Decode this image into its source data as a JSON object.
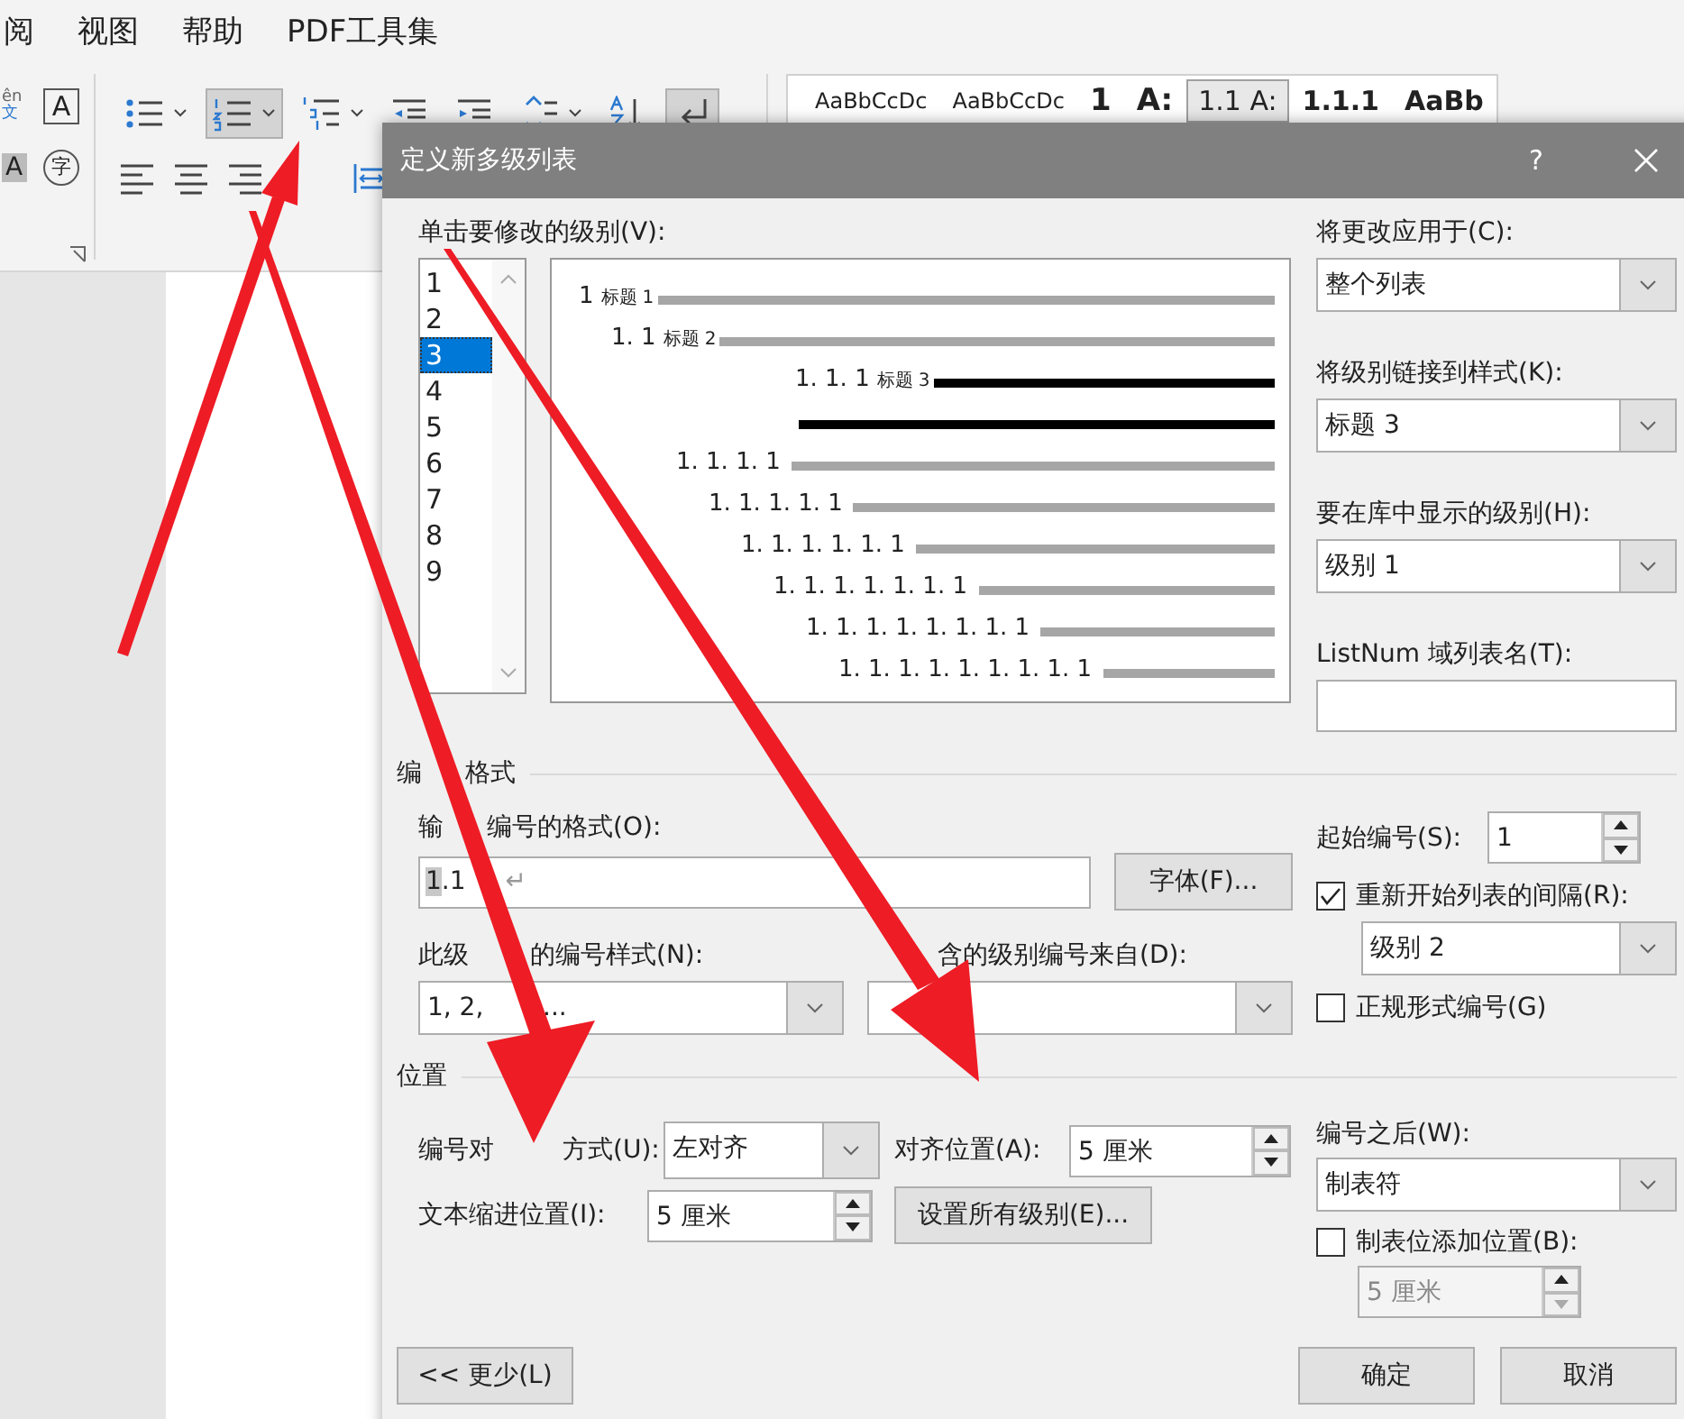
{
  "menu": [
    {
      "label": "阅"
    },
    {
      "label": "视图"
    },
    {
      "label": "帮助"
    },
    {
      "label": "PDF工具集"
    }
  ],
  "ribbon": {
    "phonetic": "ên",
    "phonetic_sub": "文",
    "char_border": "A",
    "char_shading": "A",
    "enclose": "字",
    "row1": [
      {
        "kind": "bullets",
        "selected": false,
        "caret": true
      },
      {
        "kind": "numbering",
        "selected": true,
        "caret": true
      },
      {
        "kind": "multilevel",
        "selected": false,
        "caret": true
      },
      {
        "kind": "outdent",
        "selected": false,
        "caret": false
      },
      {
        "kind": "indent",
        "selected": false,
        "caret": false
      },
      {
        "kind": "spacing",
        "selected": false,
        "caret": true
      },
      {
        "kind": "sort",
        "selected": false,
        "caret": false
      },
      {
        "kind": "marks",
        "selected": true,
        "caret": false
      }
    ],
    "row2": [
      {
        "kind": "left",
        "selected": false
      },
      {
        "kind": "center",
        "selected": false
      },
      {
        "kind": "right",
        "selected": false
      },
      {
        "kind": "distribute",
        "selected": false
      }
    ]
  },
  "styles": [
    {
      "text": "AaBbCcDc",
      "kind": "normal",
      "selected": false
    },
    {
      "text": "AaBbCcDc",
      "kind": "normal",
      "selected": false
    },
    {
      "text": "1",
      "kind": "big",
      "selected": false
    },
    {
      "text": "A:",
      "kind": "big",
      "selected": false
    },
    {
      "text": "1.1  A:",
      "kind": "mid",
      "selected": true
    },
    {
      "text": "1.1.1",
      "kind": "mid",
      "selected": false
    },
    {
      "text": "AaBb",
      "kind": "mid",
      "selected": false
    }
  ],
  "dialog": {
    "title": "定义新多级列表",
    "help": "?",
    "level_label": "单击要修改的级别(V):",
    "levels": [
      {
        "label": "1",
        "selected": false
      },
      {
        "label": "2",
        "selected": false
      },
      {
        "label": "3",
        "selected": true
      },
      {
        "label": "4",
        "selected": false
      },
      {
        "label": "5",
        "selected": false
      },
      {
        "label": "6",
        "selected": false
      },
      {
        "label": "7",
        "selected": false
      },
      {
        "label": "8",
        "selected": false
      },
      {
        "label": "9",
        "selected": false
      }
    ],
    "preview": [
      {
        "number": "1",
        "heading": "标题",
        "heading_level": "1",
        "selected": false
      },
      {
        "number": "1. 1",
        "heading": "标题",
        "heading_level": "2",
        "selected": false
      },
      {
        "number": "1. 1. 1",
        "heading": "标题",
        "heading_level": "3",
        "selected": true
      },
      {
        "number": "1. 1. 1. 1",
        "selected": false
      },
      {
        "number": "1. 1. 1. 1. 1",
        "selected": false
      },
      {
        "number": "1. 1. 1. 1. 1. 1",
        "selected": false
      },
      {
        "number": "1. 1. 1. 1. 1. 1. 1",
        "selected": false
      },
      {
        "number": "1. 1. 1. 1. 1. 1. 1. 1",
        "selected": false
      },
      {
        "number": "1. 1. 1. 1. 1. 1. 1. 1. 1",
        "selected": false
      }
    ],
    "apply_to": {
      "label": "将更改应用于(C):",
      "value": "整个列表"
    },
    "link_style": {
      "label": "将级别链接到样式(K):",
      "value": "标题 3"
    },
    "gallery_level": {
      "label": "要在库中显示的级别(H):",
      "value": "级别 1"
    },
    "listnum": {
      "label": "ListNum 域列表名(T):"
    },
    "format_section": [
      "编",
      "格式"
    ],
    "format_input": {
      "label": [
        "输",
        "编号的格式(O):"
      ],
      "field": "1",
      "text": ".1",
      "mark": "↵"
    },
    "font_button": "字体(F)...",
    "style": {
      "label": [
        "此级",
        "的编号样式(N):"
      ],
      "value": [
        "1, 2,",
        "..."
      ]
    },
    "include_label": "含的级别编号来自(D):",
    "start": {
      "label": "起始编号(S):",
      "value": "1"
    },
    "restart": {
      "label": "重新开始列表的间隔(R):",
      "checked": true,
      "value": "级别 2"
    },
    "legal": {
      "label": "正规形式编号(G)",
      "checked": false
    },
    "position_section": "位置",
    "align": {
      "label": [
        "编号对",
        "方式(U):"
      ],
      "value": "左对齐"
    },
    "align_at": {
      "label": "对齐位置(A):",
      "value": "5 厘米"
    },
    "indent": {
      "label": "文本缩进位置(I):",
      "value": "5 厘米"
    },
    "set_all_button": "设置所有级别(E)...",
    "follow": {
      "label": "编号之后(W):",
      "value": "制表符"
    },
    "tab_stop": {
      "label": "制表位添加位置(B):",
      "checked": false,
      "value": "5 厘米",
      "disabled": true
    },
    "less_button": "<< 更少(L)",
    "ok_button": "确定",
    "cancel_button": "取消"
  }
}
